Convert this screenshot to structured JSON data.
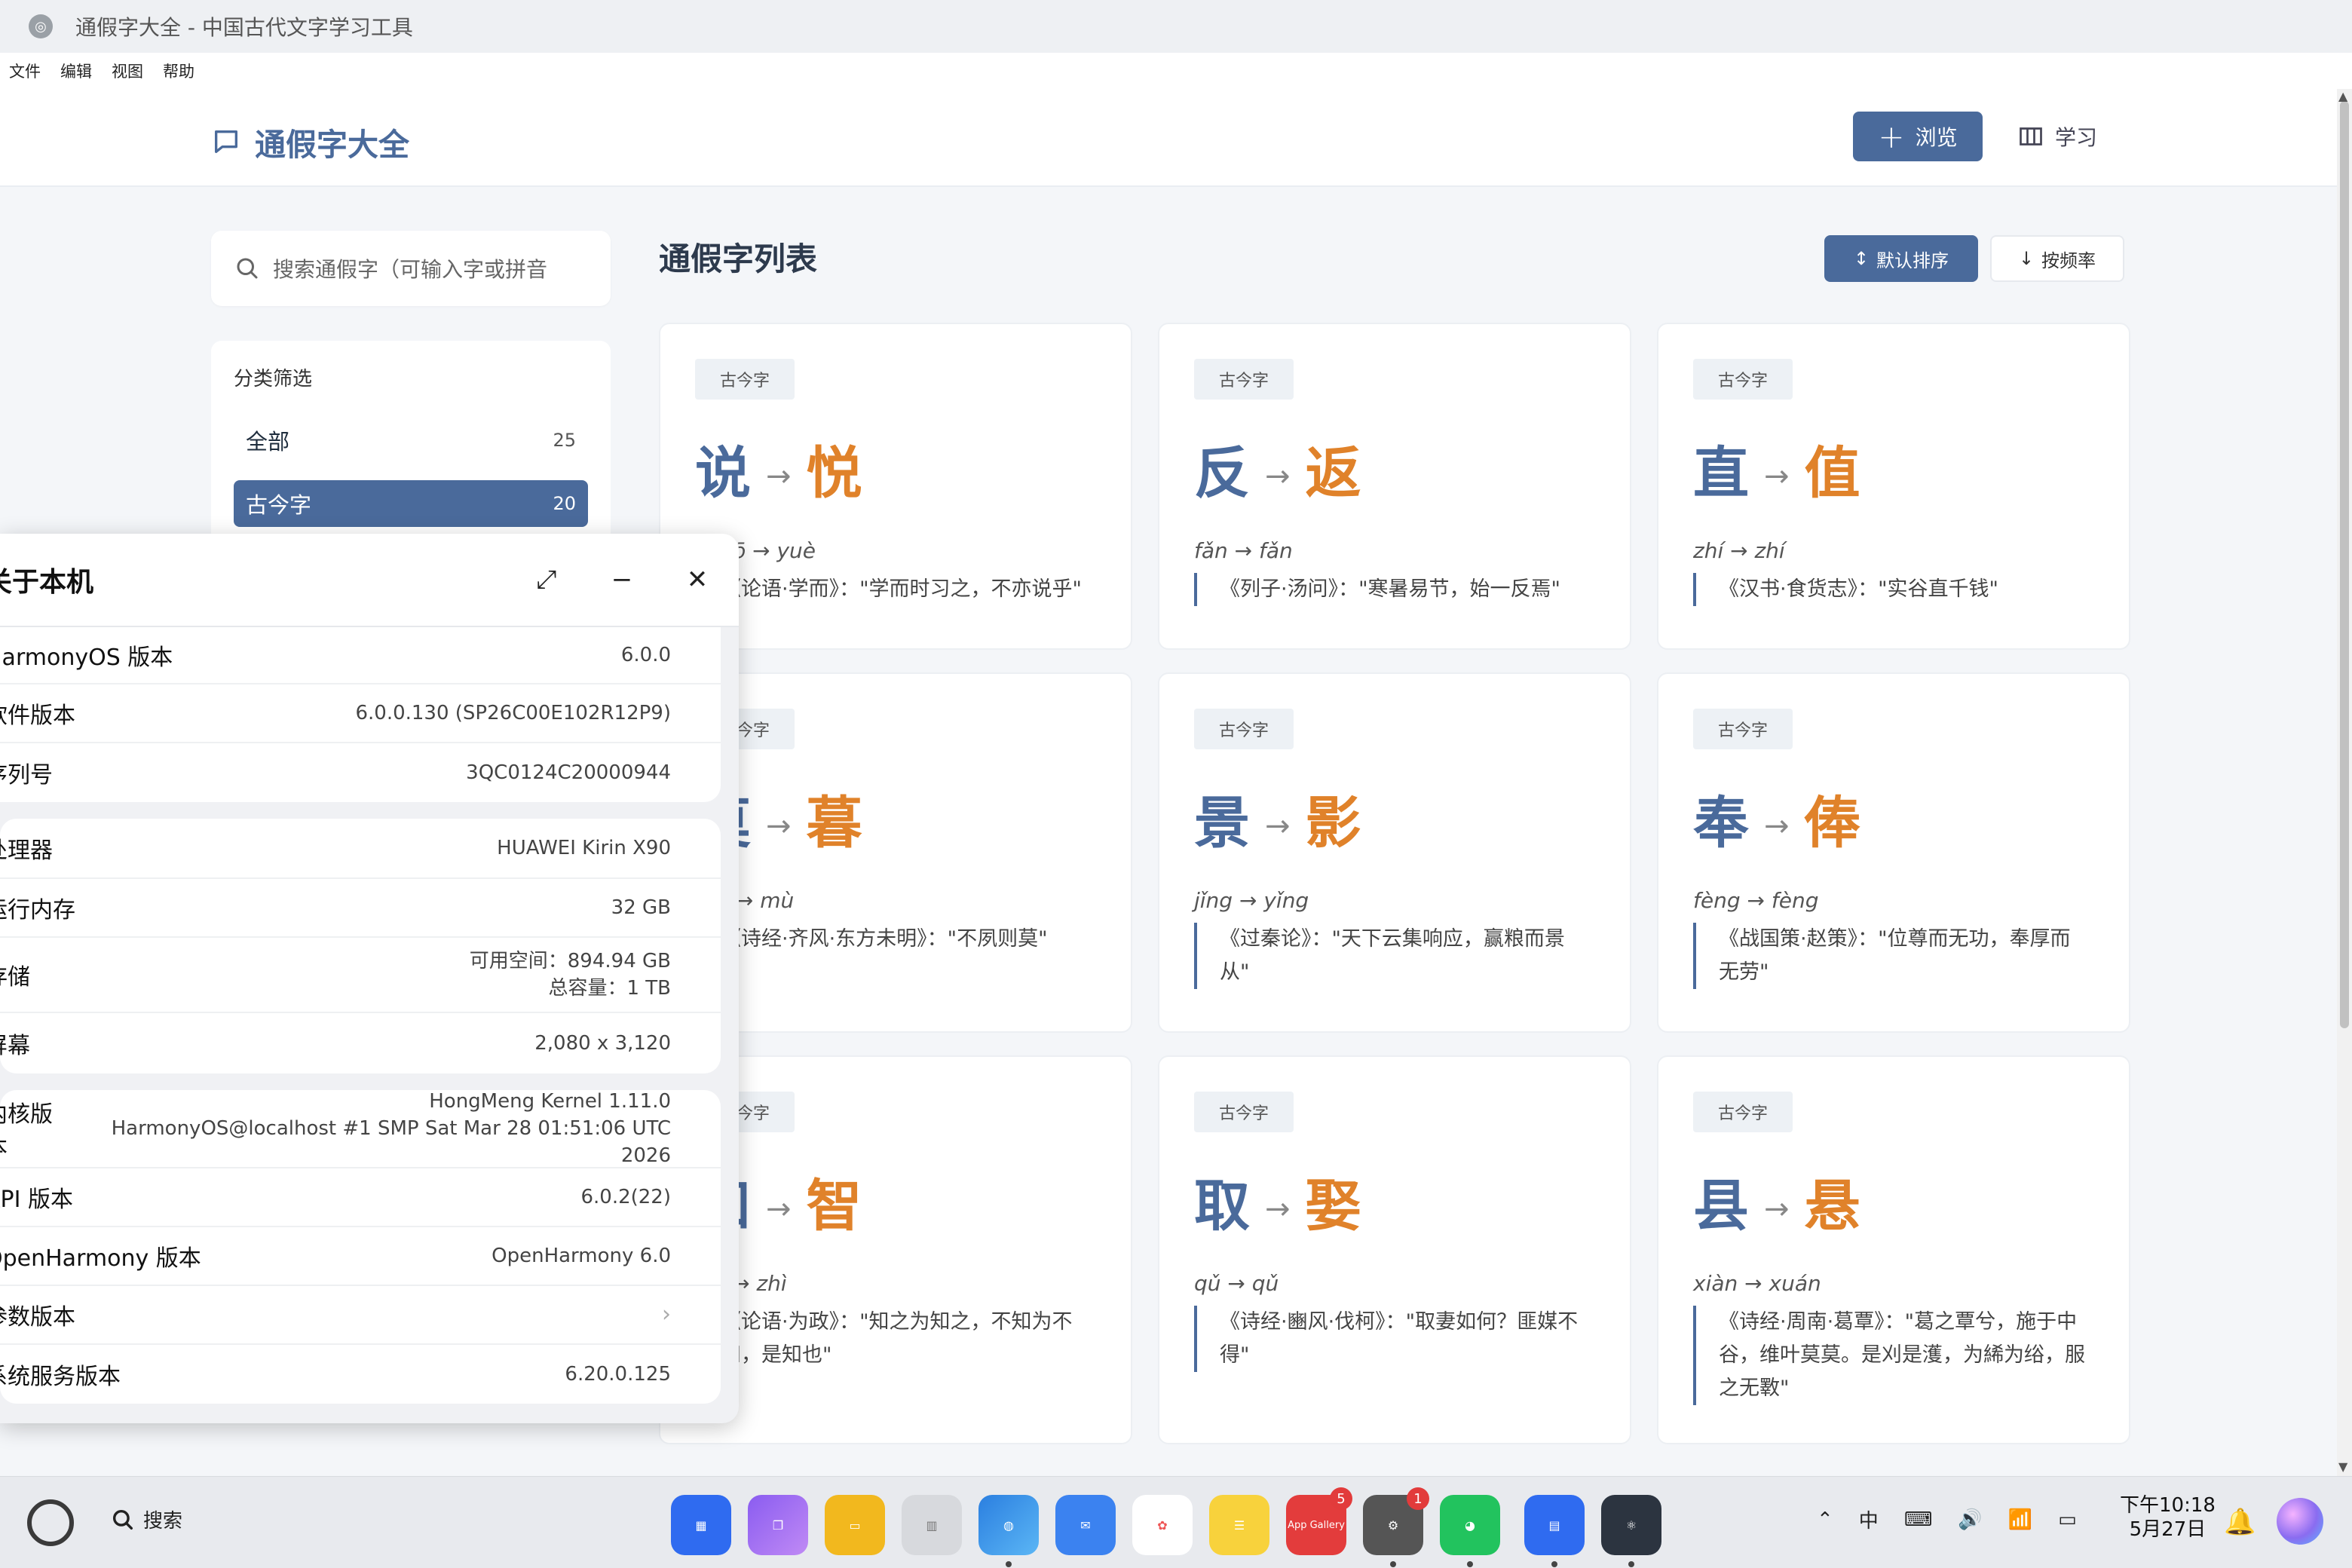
{
  "window": {
    "title": "通假字大全 - 中国古代文字学习工具"
  },
  "menu": [
    "文件",
    "编辑",
    "视图",
    "帮助"
  ],
  "header": {
    "brand": "通假字大全",
    "browse_label": "浏览",
    "learn_label": "学习"
  },
  "sidebar": {
    "search_placeholder": "搜索通假字（可输入字或拼音",
    "filter_title": "分类筛选",
    "filters": [
      {
        "label": "全部",
        "count": "25"
      },
      {
        "label": "古今字",
        "count": "20"
      }
    ]
  },
  "main": {
    "list_title": "通假字列表",
    "sort_default_label": "默认排序",
    "sort_freq_label": "按频率",
    "cards": [
      {
        "tag": "古今字",
        "from": "说",
        "to": "悦",
        "pinyin": "shuō → yuè",
        "quote": "《论语·学而》：\"学而时习之，不亦说乎\""
      },
      {
        "tag": "古今字",
        "from": "反",
        "to": "返",
        "pinyin": "fǎn → fǎn",
        "quote": "《列子·汤问》：\"寒暑易节，始一反焉\""
      },
      {
        "tag": "古今字",
        "from": "直",
        "to": "值",
        "pinyin": "zhí → zhí",
        "quote": "《汉书·食货志》：\"实谷直千钱\""
      },
      {
        "tag": "古今字",
        "from": "莫",
        "to": "暮",
        "pinyin": "mù → mù",
        "quote": "《诗经·齐风·东方未明》：\"不夙则莫\""
      },
      {
        "tag": "古今字",
        "from": "景",
        "to": "影",
        "pinyin": "jǐng → yǐng",
        "quote": "《过秦论》：\"天下云集响应，赢粮而景从\""
      },
      {
        "tag": "古今字",
        "from": "奉",
        "to": "俸",
        "pinyin": "fèng → fèng",
        "quote": "《战国策·赵策》：\"位尊而无功，奉厚而无劳\""
      },
      {
        "tag": "古今字",
        "from": "知",
        "to": "智",
        "pinyin": "zhī → zhì",
        "quote": "《论语·为政》：\"知之为知之，不知为不知，是知也\""
      },
      {
        "tag": "古今字",
        "from": "取",
        "to": "娶",
        "pinyin": "qǔ → qǔ",
        "quote": "《诗经·豳风·伐柯》：\"取妻如何？匪媒不得\""
      },
      {
        "tag": "古今字",
        "from": "县",
        "to": "悬",
        "pinyin": "xiàn → xuán",
        "quote": "《诗经·周南·葛覃》：\"葛之覃兮，施于中谷，维叶莫莫。是刈是濩，为絺为绤，服之无斁\""
      }
    ]
  },
  "dialog": {
    "title": "关于本机",
    "groups": [
      [
        {
          "label": "HarmonyOS 版本",
          "value": "6.0.0"
        },
        {
          "label": "软件版本",
          "value": "6.0.0.130 (SP26C00E102R12P9)"
        },
        {
          "label": "序列号",
          "value": "3QC0124C20000944"
        }
      ],
      [
        {
          "label": "处理器",
          "value": "HUAWEI Kirin X90"
        },
        {
          "label": "运行内存",
          "value": "32 GB"
        },
        {
          "label": "存储",
          "value": "可用空间：894.94 GB",
          "value2": "总容量：1 TB"
        },
        {
          "label": "屏幕",
          "value": "2,080 x 3,120"
        }
      ],
      [
        {
          "label": "内核版本",
          "value": "HongMeng Kernel 1.11.0",
          "value2": "HarmonyOS@localhost #1 SMP Sat Mar 28 01:51:06 UTC 2026"
        },
        {
          "label": "API 版本",
          "value": "6.0.2(22)"
        },
        {
          "label": "OpenHarmony 版本",
          "value": "OpenHarmony 6.0"
        },
        {
          "label": "参数版本",
          "value": ""
        },
        {
          "label": "系统服务版本",
          "value": "6.20.0.125"
        }
      ]
    ]
  },
  "taskbar": {
    "search_label": "搜索",
    "ime": "中",
    "time": "下午10:18",
    "date": "5月27日",
    "app_gallery_label": "App Gallery",
    "badge_gallery": "5",
    "badge_settings": "1"
  }
}
